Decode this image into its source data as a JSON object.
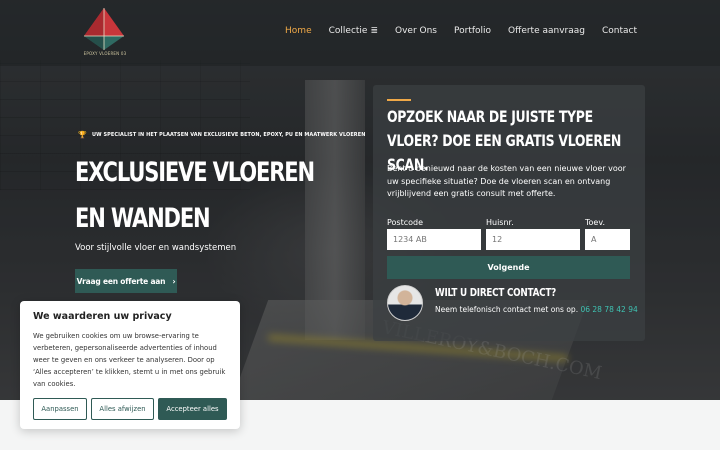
{
  "header": {
    "logo_text": "EPOXY VLOEREN 03",
    "nav": [
      {
        "label": "Home",
        "active": true
      },
      {
        "label": "Collectie",
        "has_menu": true
      },
      {
        "label": "Over Ons"
      },
      {
        "label": "Portfolio"
      },
      {
        "label": "Offerte aanvraag"
      },
      {
        "label": "Contact"
      }
    ]
  },
  "hero": {
    "tagline": "UW SPECIALIST IN HET PLAATSEN VAN EXCLUSIEVE BETON, EPOXY, PU EN MAATWERK VLOEREN",
    "title": "EXCLUSIEVE VLOEREN EN WANDEN",
    "subtitle": "Voor stijlvolle vloer en wandsystemen",
    "cta_label": "Vraag een offerte aan",
    "watermark": "VILLEROY&BOCH.COM"
  },
  "scan_form": {
    "title": "OPZOEK NAAR DE JUISTE TYPE VLOER? DOE EEN GRATIS VLOEREN SCAN.",
    "description": "Bent u benieuwd naar de kosten van een nieuwe vloer voor uw specifieke situatie? Doe de vloeren scan en ontvang vrijblijvend een gratis consult met offerte.",
    "postcode_label": "Postcode",
    "postcode_placeholder": "1234 AB",
    "huisnr_label": "Huisnr.",
    "huisnr_placeholder": "12",
    "toev_label": "Toev.",
    "toev_placeholder": "A",
    "next_label": "Volgende",
    "contact_title": "WILT U DIRECT CONTACT?",
    "contact_text": "Neem telefonisch contact met ons op.",
    "contact_phone": "06 28 78 42 94"
  },
  "cookie_banner": {
    "title": "We waarderen uw privacy",
    "body": "We gebruiken cookies om uw browse-ervaring te verbeteren, gepersonaliseerde advertenties of inhoud weer te geven en ons verkeer te analyseren. Door op ‘Alles accepteren’ te klikken, stemt u in met ons gebruik van cookies.",
    "customize_label": "Aanpassen",
    "reject_label": "Alles afwijzen",
    "accept_label": "Accepteer alles"
  },
  "colors": {
    "accent": "#f0a948",
    "brand": "#2f5a55",
    "phone": "#3fc2b2"
  }
}
